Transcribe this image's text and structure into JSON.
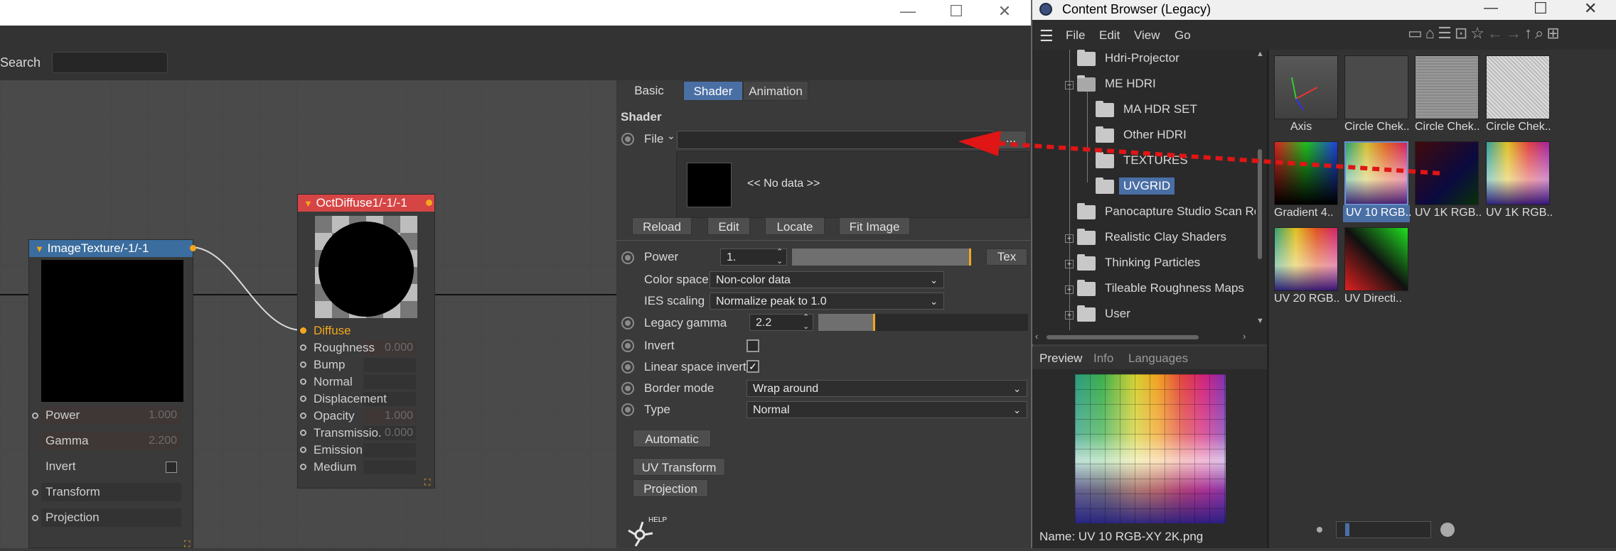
{
  "left_window": {
    "search_label": "Search",
    "window_controls": [
      "—",
      "☐",
      "✕"
    ]
  },
  "nodes": {
    "image_texture": {
      "title": "ImageTexture/-1/-1",
      "rows": [
        {
          "label": "Power",
          "value": "1.000"
        },
        {
          "label": "Gamma",
          "value": "2.200"
        },
        {
          "label": "Invert",
          "value": ""
        },
        {
          "label": "Transform",
          "value": ""
        },
        {
          "label": "Projection",
          "value": ""
        }
      ]
    },
    "oct_diffuse": {
      "title": "OctDiffuse1/-1/-1",
      "rows": [
        {
          "label": "Diffuse",
          "value": ""
        },
        {
          "label": "Roughness",
          "value": "0.000"
        },
        {
          "label": "Bump",
          "value": ""
        },
        {
          "label": "Normal",
          "value": ""
        },
        {
          "label": "Displacement",
          "value": ""
        },
        {
          "label": "Opacity",
          "value": "1.000"
        },
        {
          "label": "Transmissio.",
          "value": "0.000"
        },
        {
          "label": "Emission",
          "value": ""
        },
        {
          "label": "Medium",
          "value": ""
        }
      ]
    }
  },
  "attributes": {
    "tabs": [
      "Basic",
      "Shader",
      "Animation"
    ],
    "active_tab": "Shader",
    "section_title": "Shader",
    "file_label": "File",
    "file_value": "",
    "file_browse": "...",
    "no_data": "<< No data >>",
    "buttons": [
      "Reload",
      "Edit",
      "Locate",
      "Fit Image"
    ],
    "power_label": "Power",
    "power_value": "1.",
    "tex_button": "Tex",
    "color_space_label": "Color space",
    "color_space_value": "Non-color data",
    "ies_label": "IES scaling",
    "ies_value": "Normalize peak to 1.0",
    "legacy_gamma_label": "Legacy gamma",
    "legacy_gamma_value": "2.2",
    "invert_label": "Invert",
    "lsi_label": "Linear space invert",
    "lsi_check": "✓",
    "border_label": "Border mode",
    "border_value": "Wrap around",
    "type_label": "Type",
    "type_value": "Normal",
    "automatic_button": "Automatic",
    "uv_transform_button": "UV Transform",
    "projection_button": "Projection",
    "help_label": "HELP"
  },
  "content_browser": {
    "title": "Content Browser (Legacy)",
    "menu": [
      "File",
      "Edit",
      "View",
      "Go"
    ],
    "tree": [
      {
        "label": "Hdri-Projector",
        "expander": ""
      },
      {
        "label": "ME HDRI",
        "expander": "−"
      },
      {
        "label": "MA HDR SET",
        "expander": ""
      },
      {
        "label": "Other HDRI",
        "expander": ""
      },
      {
        "label": "TEXTURES",
        "expander": ""
      },
      {
        "label": "UVGRID",
        "expander": ""
      },
      {
        "label": "Panocapture Studio Scan Ro",
        "expander": ""
      },
      {
        "label": "Realistic Clay Shaders",
        "expander": "+"
      },
      {
        "label": "Thinking Particles",
        "expander": "+"
      },
      {
        "label": "Tileable Roughness Maps",
        "expander": "+"
      },
      {
        "label": "User",
        "expander": "+"
      }
    ],
    "selected_tree_item": "UVGRID",
    "thumbnails": [
      {
        "label": "Axis"
      },
      {
        "label": "Circle Chek.."
      },
      {
        "label": "Circle Chek.."
      },
      {
        "label": "Circle Chek.."
      },
      {
        "label": "Gradient 4.."
      },
      {
        "label": "UV 10 RGB.."
      },
      {
        "label": "UV 1K RGB.."
      },
      {
        "label": "UV 1K RGB.."
      },
      {
        "label": "UV 20 RGB.."
      },
      {
        "label": "UV Directi.."
      }
    ],
    "preview_tabs": [
      "Preview",
      "Info",
      "Languages"
    ],
    "name_label": "Name:  UV 10 RGB-XY 2K.png"
  },
  "colors": {
    "accent": "#4a6fa5",
    "node_header_red": "#d64545",
    "node_header_blue": "#3b6d9e",
    "port_orange": "#f3a71c",
    "arrow_red": "#e01515"
  }
}
